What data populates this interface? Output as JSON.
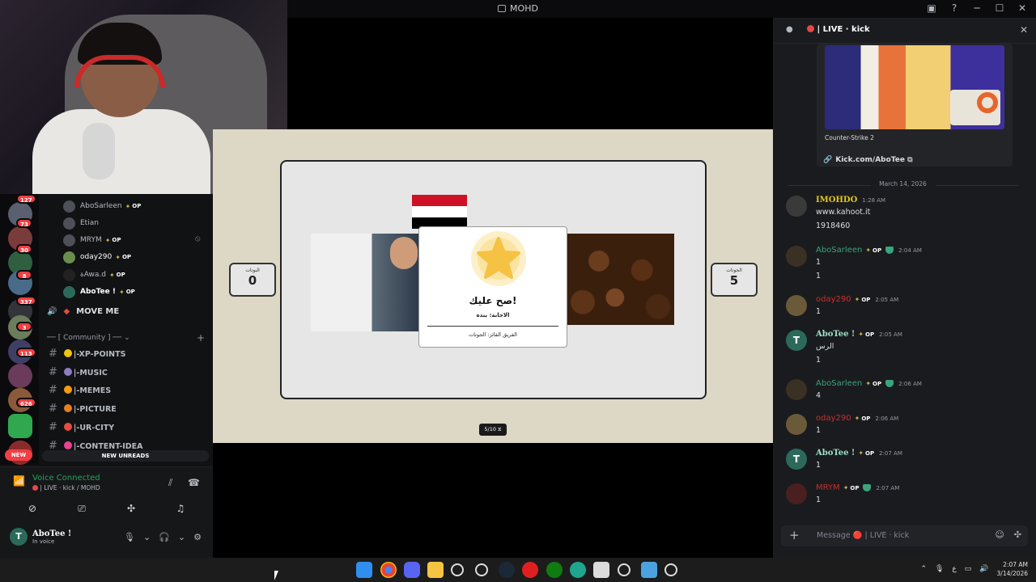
{
  "window": {
    "title": "MOHD",
    "controls": [
      "gallery-icon",
      "help-icon",
      "minimize-icon",
      "maximize-icon",
      "close-icon"
    ]
  },
  "servers": {
    "badges": [
      "127",
      "73",
      "30",
      "8",
      "337",
      "3",
      "113",
      "626"
    ],
    "new_label": "NEW"
  },
  "voice_channel": {
    "users": [
      {
        "name": "AboSarleen",
        "tag": "OP"
      },
      {
        "name": "Etian",
        "tag": ""
      },
      {
        "name": "MRYM",
        "tag": "OP"
      },
      {
        "name": "oday290",
        "tag": "OP"
      },
      {
        "name": "ةAwa.d",
        "tag": "OP"
      },
      {
        "name": "AboTee !",
        "tag": "OP"
      }
    ],
    "move_me": "MOVE ME"
  },
  "category": {
    "label": "── [ Community ] ──"
  },
  "channels": [
    {
      "label": "|-XP-POINTS",
      "color": "#f1c40f"
    },
    {
      "label": "|-MUSIC",
      "color": "#8e7cc3"
    },
    {
      "label": "|-MEMES",
      "color": "#f39c12"
    },
    {
      "label": "|-PICTURE",
      "color": "#e67e22"
    },
    {
      "label": "|-UR-CITY",
      "color": "#e74c3c"
    },
    {
      "label": "|-CONTENT-IDEA",
      "color": "#e84393"
    }
  ],
  "new_unreads": "NEW UNREADS",
  "voice_panel": {
    "status": "Voice Connected",
    "location": "| LIVE · kick / MOHD"
  },
  "me": {
    "name": "AboTee !",
    "status": "In voice",
    "initial": "T"
  },
  "game": {
    "left_team_label": "البوتات",
    "left_score": "0",
    "right_team_label": "الجوتات",
    "right_score": "5",
    "popup_title": "صح عليك!",
    "popup_answer": "الاجابة: بنده",
    "popup_winner": "الفريق الفائز: الجوتات",
    "progress": "5/10 ⧖",
    "flag_colors": [
      "#ce1126",
      "#ffffff",
      "#000000"
    ]
  },
  "chat": {
    "header": "| LIVE · kick",
    "embed_caption": "Counter-Strike 2",
    "link": "Kick.com/AboTee",
    "date": "March 14, 2026",
    "messages": [
      {
        "author": "IMOHDO",
        "style": "yellow",
        "op": false,
        "shield": false,
        "time": "1:28 AM",
        "lines": [
          "www.kahoot.it",
          "1918460"
        ]
      },
      {
        "author": "AboSarleen",
        "style": "green",
        "op": true,
        "shield": true,
        "time": "2:04 AM",
        "lines": [
          "1",
          "1"
        ]
      },
      {
        "author": "oday290",
        "style": "red",
        "op": true,
        "shield": false,
        "time": "2:05 AM",
        "lines": [
          "1"
        ]
      },
      {
        "author": "AboTee !",
        "style": "mint",
        "op": true,
        "shield": false,
        "time": "2:05 AM",
        "lines": [
          "الرس",
          "1"
        ]
      },
      {
        "author": "AboSarleen",
        "style": "green",
        "op": true,
        "shield": true,
        "time": "2:06 AM",
        "lines": [
          "4"
        ]
      },
      {
        "author": "oday290",
        "style": "red",
        "op": true,
        "shield": false,
        "time": "2:06 AM",
        "lines": [
          "1"
        ]
      },
      {
        "author": "AboTee !",
        "style": "mint",
        "op": true,
        "shield": false,
        "time": "2:07 AM",
        "lines": [
          "1"
        ]
      },
      {
        "author": "MRYM",
        "style": "red",
        "op": true,
        "shield": true,
        "time": "2:07 AM",
        "lines": [
          "1"
        ]
      }
    ],
    "composer_placeholder": "Message 🔴 | LIVE · kick"
  },
  "taskbar": {
    "icons": [
      "windows-start-icon",
      "chrome-icon",
      "discord-icon",
      "file-explorer-icon",
      "sync-icon",
      "settings-icon",
      "steam-icon",
      "youtube-icon",
      "xbox-icon",
      "edge-icon",
      "store-icon",
      "gear-icon",
      "notepad-icon",
      "obs-icon"
    ],
    "time": "2:07 AM",
    "date": "3/14/2026",
    "lang": "ع"
  }
}
